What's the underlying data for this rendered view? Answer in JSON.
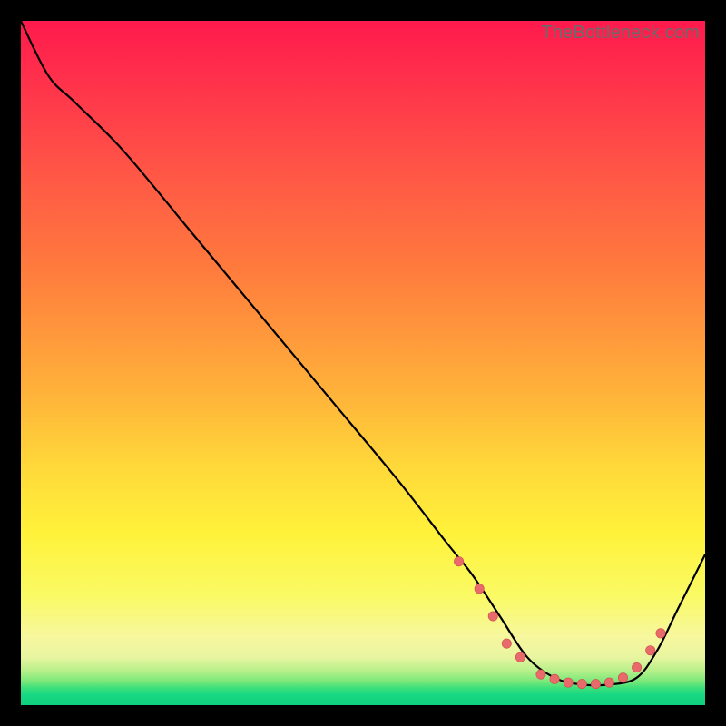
{
  "domain": "Chart",
  "attribution": "TheBottleneck.com",
  "colors": {
    "page_bg": "#000000",
    "gradient_top": "#ff1a4d",
    "gradient_mid": "#fff23a",
    "gradient_bottom": "#10d07e",
    "curve": "#000000",
    "dot_fill": "#e86a6a",
    "dot_stroke": "#d04e4e"
  },
  "chart_data": {
    "type": "line",
    "title": "",
    "xlabel": "",
    "ylabel": "",
    "xlim": [
      0,
      100
    ],
    "ylim": [
      0,
      100
    ],
    "grid": false,
    "legend": false,
    "note": "Single unlabeled curve over a vertical red→yellow→green gradient. x and y are normalized 0–100 (left→right, bottom→top). Values estimated from pixels.",
    "series": [
      {
        "name": "curve",
        "x": [
          0,
          4,
          8,
          15,
          25,
          35,
          45,
          55,
          62,
          66,
          70,
          74,
          78,
          82,
          86,
          90,
          93,
          96,
          100
        ],
        "y": [
          100,
          92,
          88,
          81,
          69,
          57,
          45,
          33,
          24,
          19,
          13,
          7,
          4,
          3,
          3,
          4,
          8,
          14,
          22
        ]
      }
    ],
    "markers": [
      {
        "x": 64,
        "y": 21
      },
      {
        "x": 67,
        "y": 17
      },
      {
        "x": 69,
        "y": 13
      },
      {
        "x": 71,
        "y": 9
      },
      {
        "x": 73,
        "y": 7
      },
      {
        "x": 76,
        "y": 4.5
      },
      {
        "x": 78,
        "y": 3.8
      },
      {
        "x": 80,
        "y": 3.3
      },
      {
        "x": 82,
        "y": 3.1
      },
      {
        "x": 84,
        "y": 3.1
      },
      {
        "x": 86,
        "y": 3.3
      },
      {
        "x": 88,
        "y": 4.0
      },
      {
        "x": 90,
        "y": 5.5
      },
      {
        "x": 92,
        "y": 8.0
      },
      {
        "x": 93.5,
        "y": 10.5
      }
    ]
  }
}
